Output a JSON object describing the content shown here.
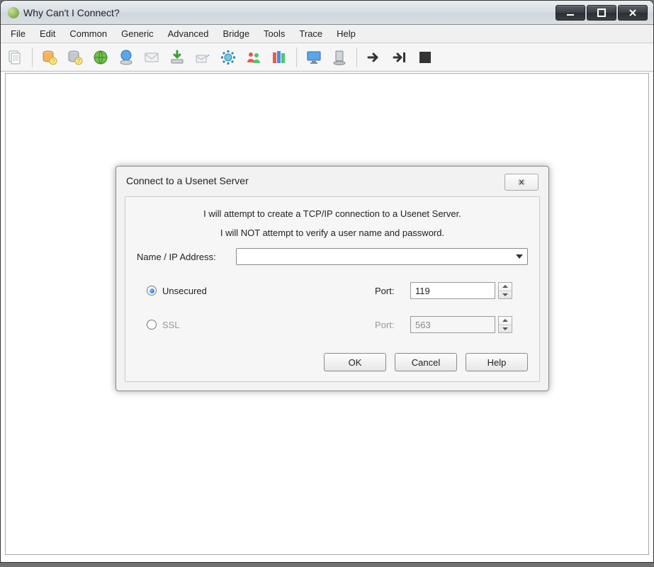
{
  "window": {
    "title": "Why Can't I Connect?"
  },
  "menu": {
    "items": [
      "File",
      "Edit",
      "Common",
      "Generic",
      "Advanced",
      "Bridge",
      "Tools",
      "Trace",
      "Help"
    ]
  },
  "toolbar": {
    "icons": [
      "documents-icon",
      "db-add-icon",
      "db-question-icon",
      "globe-icon",
      "globe-cloud-icon",
      "envelope-icon",
      "download-icon",
      "mail-send-icon",
      "gear-cog-icon",
      "people-icon",
      "books-icon",
      "monitor-icon",
      "server-icon",
      "arrow-right-icon",
      "arrow-end-icon",
      "stop-icon"
    ]
  },
  "dialog": {
    "title": "Connect to a Usenet Server",
    "line1": "I will attempt to create a TCP/IP connection to a Usenet Server.",
    "line2": "I will NOT attempt to verify a user name and password.",
    "name_label": "Name / IP Address:",
    "name_value": "",
    "unsecured": {
      "label": "Unsecured",
      "port_label": "Port:",
      "port_value": "119",
      "checked": true
    },
    "ssl": {
      "label": "SSL",
      "port_label": "Port:",
      "port_value": "563",
      "checked": false
    },
    "ok": "OK",
    "cancel": "Cancel",
    "help": "Help"
  }
}
